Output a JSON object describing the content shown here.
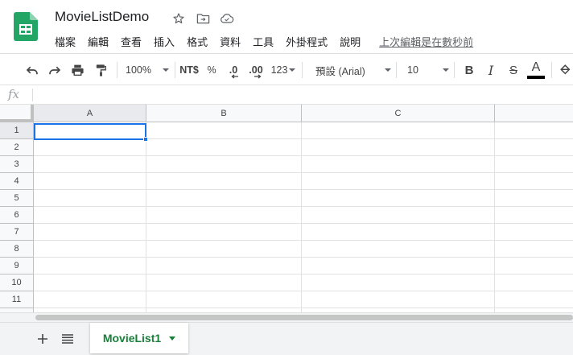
{
  "document": {
    "title": "MovieListDemo",
    "last_edit": "上次編輯是在數秒前"
  },
  "menu": {
    "items": [
      {
        "label": "檔案"
      },
      {
        "label": "編輯"
      },
      {
        "label": "查看"
      },
      {
        "label": "插入"
      },
      {
        "label": "格式"
      },
      {
        "label": "資料"
      },
      {
        "label": "工具"
      },
      {
        "label": "外掛程式"
      },
      {
        "label": "說明"
      }
    ]
  },
  "toolbar": {
    "zoom": "100%",
    "currency": "NT$",
    "percent": "%",
    "decrease_decimal": ".0",
    "increase_decimal": ".00",
    "more_formats": "123",
    "font": "預設 (Arial)",
    "font_size": "10",
    "bold": "B",
    "italic": "I",
    "strike": "S",
    "text_color": "A"
  },
  "formula_bar": {
    "fx_label": "fx",
    "value": ""
  },
  "grid": {
    "columns": [
      "A",
      "B",
      "C"
    ],
    "rows": [
      "1",
      "2",
      "3",
      "4",
      "5",
      "6",
      "7",
      "8",
      "9",
      "10",
      "11"
    ],
    "selected_cell": "A1"
  },
  "sheets": {
    "tabs": [
      {
        "label": "MovieList1"
      }
    ]
  },
  "colors": {
    "accent_blue": "#1a73e8",
    "sheet_green": "#188038",
    "logo_green": "#23a566"
  }
}
